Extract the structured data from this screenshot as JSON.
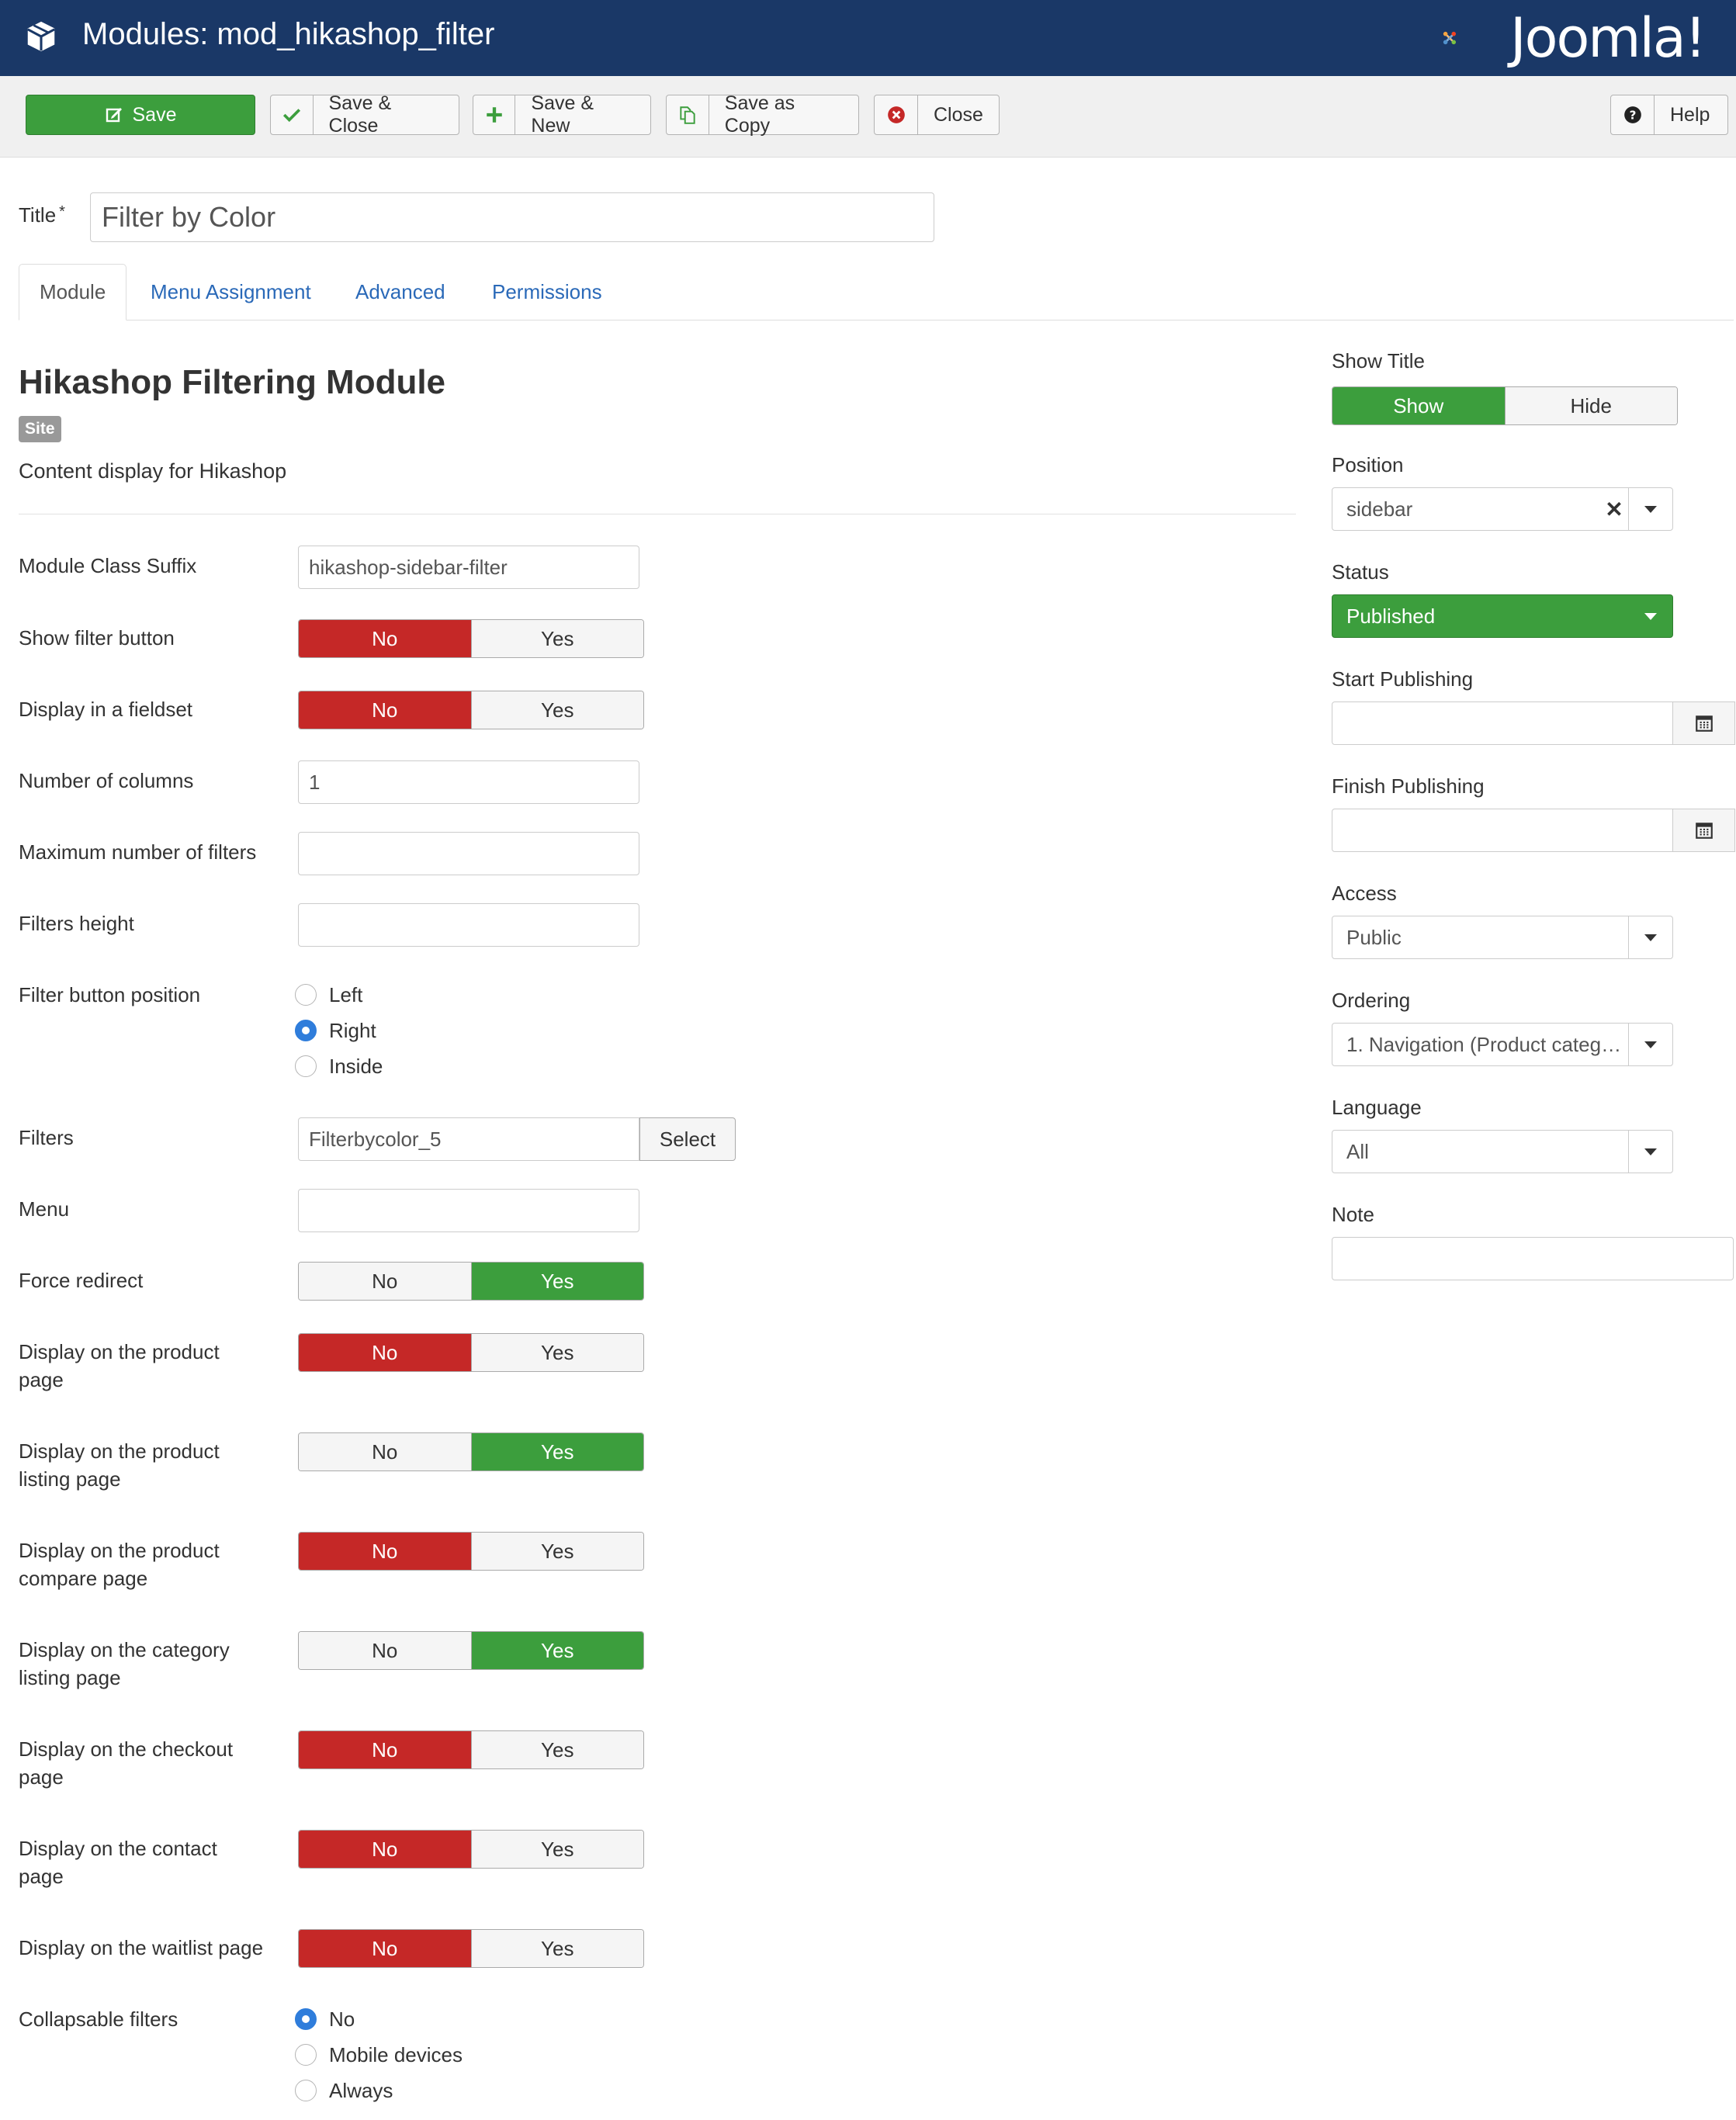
{
  "header": {
    "title": "Modules: mod_hikashop_filter",
    "logo_text": "Joomla!"
  },
  "toolbar": {
    "save": "Save",
    "save_close": "Save & Close",
    "save_new": "Save & New",
    "save_copy": "Save as Copy",
    "close": "Close",
    "help": "Help"
  },
  "title_field": {
    "label": "Title",
    "required_mark": "*",
    "value": "Filter by Color"
  },
  "tabs": [
    "Module",
    "Menu Assignment",
    "Advanced",
    "Permissions"
  ],
  "module": {
    "heading": "Hikashop Filtering Module",
    "badge": "Site",
    "description": "Content display for Hikashop"
  },
  "fields": {
    "class_suffix": {
      "label": "Module Class Suffix",
      "value": "hikashop-sidebar-filter"
    },
    "show_filter_button": {
      "label": "Show filter button",
      "no": "No",
      "yes": "Yes",
      "selected": "No"
    },
    "display_fieldset": {
      "label": "Display in a fieldset",
      "no": "No",
      "yes": "Yes",
      "selected": "No"
    },
    "num_columns": {
      "label": "Number of columns",
      "value": "1"
    },
    "max_filters": {
      "label": "Maximum number of filters",
      "value": ""
    },
    "filters_height": {
      "label": "Filters height",
      "value": ""
    },
    "filter_button_position": {
      "label": "Filter button position",
      "options": [
        "Left",
        "Right",
        "Inside"
      ],
      "selected": "Right"
    },
    "filters": {
      "label": "Filters",
      "value": "Filterbycolor_5",
      "button": "Select"
    },
    "menu": {
      "label": "Menu",
      "value": ""
    },
    "force_redirect": {
      "label": "Force redirect",
      "no": "No",
      "yes": "Yes",
      "selected": "Yes"
    },
    "product_page": {
      "label_1": "Display on the product",
      "label_2": "page",
      "no": "No",
      "yes": "Yes",
      "selected": "No"
    },
    "product_listing": {
      "label_1": "Display on the product",
      "label_2": "listing page",
      "no": "No",
      "yes": "Yes",
      "selected": "Yes"
    },
    "product_compare": {
      "label_1": "Display on the product",
      "label_2": "compare page",
      "no": "No",
      "yes": "Yes",
      "selected": "No"
    },
    "category_listing": {
      "label_1": "Display on the category",
      "label_2": "listing page",
      "no": "No",
      "yes": "Yes",
      "selected": "Yes"
    },
    "checkout_page": {
      "label_1": "Display on the checkout",
      "label_2": "page",
      "no": "No",
      "yes": "Yes",
      "selected": "No"
    },
    "contact_page": {
      "label_1": "Display on the contact",
      "label_2": "page",
      "no": "No",
      "yes": "Yes",
      "selected": "No"
    },
    "waitlist_page": {
      "label": "Display on the waitlist page",
      "no": "No",
      "yes": "Yes",
      "selected": "No"
    },
    "collapsable": {
      "label": "Collapsable filters",
      "options": [
        "No",
        "Mobile devices",
        "Always"
      ],
      "selected": "No"
    }
  },
  "sidebar": {
    "show_title": {
      "label": "Show Title",
      "show": "Show",
      "hide": "Hide",
      "selected": "Show"
    },
    "position": {
      "label": "Position",
      "value": "sidebar"
    },
    "status": {
      "label": "Status",
      "value": "Published"
    },
    "start_publishing": {
      "label": "Start Publishing",
      "value": ""
    },
    "finish_publishing": {
      "label": "Finish Publishing",
      "value": ""
    },
    "access": {
      "label": "Access",
      "value": "Public"
    },
    "ordering": {
      "label": "Ordering",
      "value": "1. Navigation (Product categ…"
    },
    "language": {
      "label": "Language",
      "value": "All"
    },
    "note": {
      "label": "Note",
      "value": ""
    }
  },
  "colors": {
    "header_bg": "#1a3867",
    "green": "#3c9e3d",
    "red": "#c52827",
    "link": "#2a69b8"
  }
}
